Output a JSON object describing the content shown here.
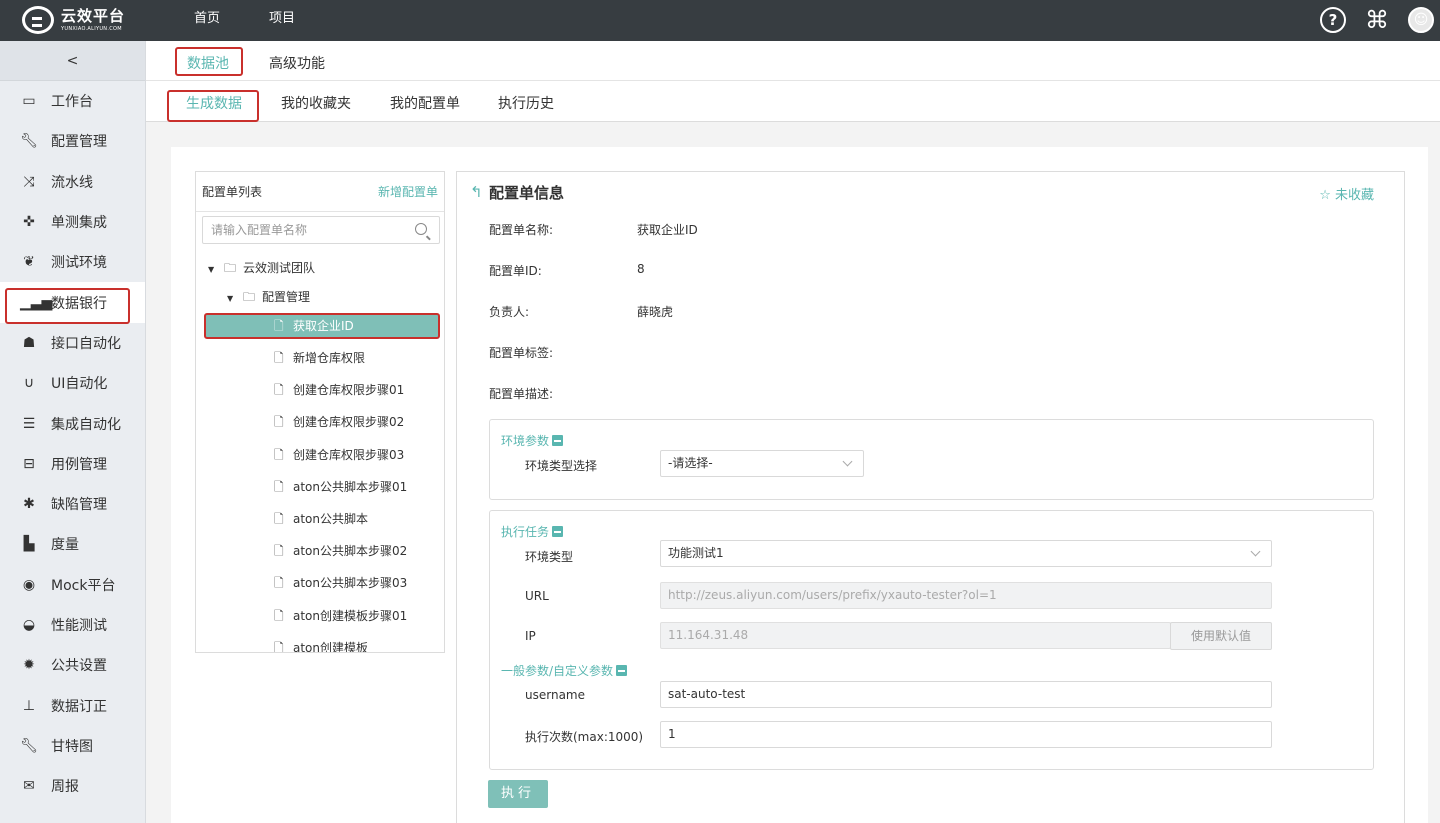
{
  "app": {
    "logo_cn": "云效平台",
    "logo_en": "YUNXIAO.ALIYUN.COM",
    "nav": [
      "首页",
      "项目"
    ],
    "help_icon": "question-circle-icon",
    "command_icon": "command-icon"
  },
  "sidebar": {
    "collapse": "<",
    "items": [
      {
        "label": "工作台",
        "icon": "monitor-icon"
      },
      {
        "label": "配置管理",
        "icon": "wrench-icon"
      },
      {
        "label": "流水线",
        "icon": "shuffle-icon"
      },
      {
        "label": "单测集成",
        "icon": "crosshair-icon"
      },
      {
        "label": "测试环境",
        "icon": "leaf-icon"
      },
      {
        "label": "数据银行",
        "icon": "signal-bars-icon"
      },
      {
        "label": "接口自动化",
        "icon": "sitemap-icon"
      },
      {
        "label": "UI自动化",
        "icon": "magnet-icon"
      },
      {
        "label": "集成自动化",
        "icon": "server-icon"
      },
      {
        "label": "用例管理",
        "icon": "inbox-icon"
      },
      {
        "label": "缺陷管理",
        "icon": "bug-icon"
      },
      {
        "label": "度量",
        "icon": "bar-chart-icon"
      },
      {
        "label": "Mock平台",
        "icon": "target-icon"
      },
      {
        "label": "性能测试",
        "icon": "dashboard-icon"
      },
      {
        "label": "公共设置",
        "icon": "gear-icon"
      },
      {
        "label": "数据订正",
        "icon": "pin-icon"
      },
      {
        "label": "甘特图",
        "icon": "wrench-icon"
      },
      {
        "label": "周报",
        "icon": "envelope-icon"
      }
    ]
  },
  "tabs_primary": [
    "数据池",
    "高级功能"
  ],
  "tabs_secondary": [
    "生成数据",
    "我的收藏夹",
    "我的配置单",
    "执行历史"
  ],
  "config_list": {
    "title": "配置单列表",
    "add": "新增配置单",
    "search_placeholder": "请输入配置单名称",
    "tree": {
      "root": "云效测试团队",
      "folder": "配置管理",
      "items": [
        "获取企业ID",
        "新增仓库权限",
        "创建仓库权限步骤01",
        "创建仓库权限步骤02",
        "创建仓库权限步骤03",
        "aton公共脚本步骤01",
        "aton公共脚本",
        "aton公共脚本步骤02",
        "aton公共脚本步骤03",
        "aton创建模板步骤01",
        "aton创建模板"
      ]
    }
  },
  "detail": {
    "title": "配置单信息",
    "favorite": "未收藏",
    "info": [
      {
        "label": "配置单名称:",
        "value": "获取企业ID"
      },
      {
        "label": "配置单ID:",
        "value": "8"
      },
      {
        "label": "负责人:",
        "value": "薛晓虎"
      },
      {
        "label": "配置单标签:",
        "value": ""
      },
      {
        "label": "配置单描述:",
        "value": ""
      }
    ],
    "env_group": {
      "title": "环境参数",
      "label": "环境类型选择",
      "select_value": "-请选择-"
    },
    "task_group": {
      "title": "执行任务",
      "env_type_label": "环境类型",
      "env_type_value": "功能测试1",
      "url_label": "URL",
      "url_value": "http://zeus.aliyun.com/users/prefix/yxauto-tester?ol=1",
      "ip_label": "IP",
      "ip_value": "11.164.31.48",
      "default_button": "使用默认值",
      "custom_title": "一般参数/自定义参数",
      "username_label": "username",
      "username_value": "sat-auto-test",
      "count_label": "执行次数(max:1000)",
      "count_value": "1"
    },
    "execute": "执行"
  }
}
